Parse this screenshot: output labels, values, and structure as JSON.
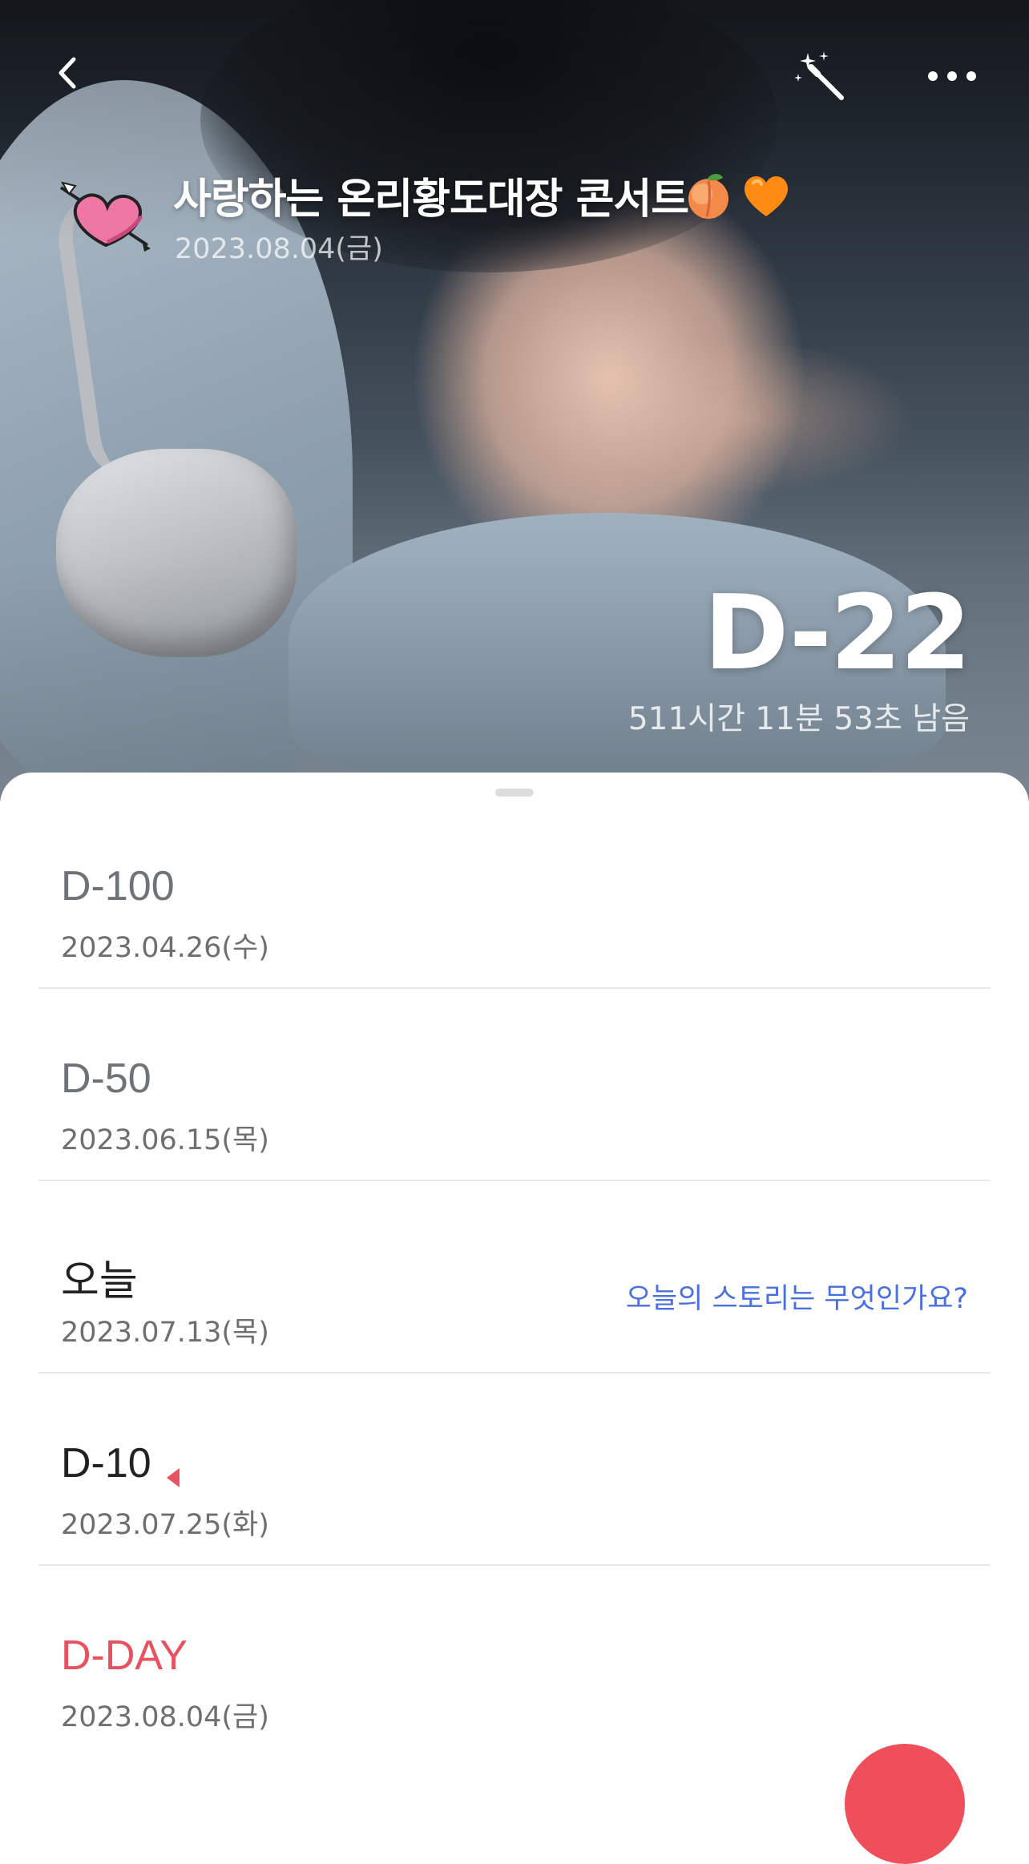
{
  "header": {
    "back_icon": "chevron-left-icon",
    "wand_icon": "magic-wand-icon",
    "more_icon": "more-horizontal-icon",
    "event_icon": "heart-arrow-icon",
    "event_title": "사랑하는 온리황도대장 콘서트",
    "title_emojis": [
      "peach-emoji",
      "orange-heart-emoji"
    ],
    "event_date": "2023.08.04(금)",
    "dday": "D-22",
    "remaining": "511시간 11분 53초 남음"
  },
  "milestones": [
    {
      "label": "D-100",
      "date": "2023.04.26(수)",
      "state": "past"
    },
    {
      "label": "D-50",
      "date": "2023.06.15(목)",
      "state": "past"
    },
    {
      "label": "오늘",
      "date": "2023.07.13(목)",
      "state": "today",
      "story_prompt": "오늘의 스토리는 무엇인가요?"
    },
    {
      "label": "D-10",
      "date": "2023.07.25(화)",
      "state": "upcoming",
      "marker": true
    },
    {
      "label": "D-DAY",
      "date": "2023.08.04(금)",
      "state": "dday"
    }
  ],
  "colors": {
    "accent_red": "#e8525e",
    "story_link": "#4a6fe0",
    "fab": "#ef4f5b"
  }
}
